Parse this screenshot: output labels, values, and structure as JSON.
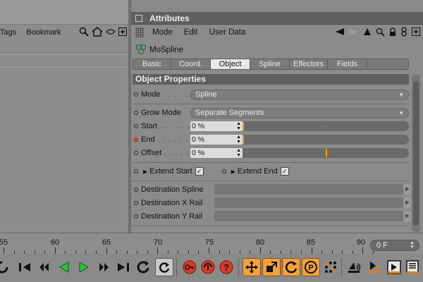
{
  "left_panel": {
    "menu": [
      "Tags",
      "Bookmark"
    ],
    "icons": [
      "search-icon",
      "home-icon",
      "eye-icon",
      "add-icon"
    ]
  },
  "attributes": {
    "title": "Attributes",
    "menu": [
      "Mode",
      "Edit",
      "User Data"
    ],
    "menu_icons": [
      "back-arrow-icon",
      "forward-arrow-icon",
      "up-arrow-icon",
      "search-icon",
      "lock-icon",
      "settings-icon",
      "add-icon"
    ],
    "object_name": "MoSpline",
    "tabs": [
      "Basic",
      "Coord.",
      "Object",
      "Spline",
      "Effectors",
      "Fields"
    ],
    "active_tab": "Object",
    "section_title": "Object Properties",
    "mode": {
      "label": "Mode",
      "dots": ". . . . . .",
      "value": "Spline"
    },
    "grow_mode": {
      "label": "Grow Mode",
      "value": "Separate Segments"
    },
    "start": {
      "label": "Start",
      "dots": ". . . . . .",
      "value": "0 %"
    },
    "end": {
      "label": "End",
      "dots": ". . . . . . .",
      "value": "0 %"
    },
    "offset": {
      "label": "Offset",
      "dots": ". . . . .",
      "value": "0 %"
    },
    "extend_start": {
      "label": "Extend Start",
      "checked": true
    },
    "extend_end": {
      "label": "Extend End",
      "checked": true
    },
    "destination_spline": {
      "label": "Destination Spline"
    },
    "destination_x_rail": {
      "label": "Destination X Rail"
    },
    "destination_y_rail": {
      "label": "Destination Y Rail"
    }
  },
  "timeline": {
    "labels": [
      "55",
      "60",
      "65",
      "70",
      "75",
      "80",
      "85",
      "90"
    ],
    "current_frame": "0 F"
  },
  "toolbar": {
    "icons": [
      "loop-icon",
      "go-to-start-icon",
      "previous-keyframe-icon",
      "play-backward-icon",
      "play-forward-icon",
      "next-keyframe-icon",
      "go-to-end-icon",
      "loop-toggle-icon",
      "playback-mode-icon",
      "record-icon",
      "autokey-icon",
      "keyframe-help-icon",
      "move-tool-icon",
      "scale-tool-icon",
      "rotate-tool-icon",
      "parameter-icon",
      "grid-points-icon",
      "sound-icon",
      "render-view-icon",
      "render-picture-viewer-icon",
      "render-settings-icon"
    ]
  },
  "colors": {
    "accent": "#f0a010",
    "active_tab": "#e6e6e6",
    "title_bar": "#5f5f5f",
    "green_play": "#30c040",
    "red_record": "#d83a2a"
  }
}
